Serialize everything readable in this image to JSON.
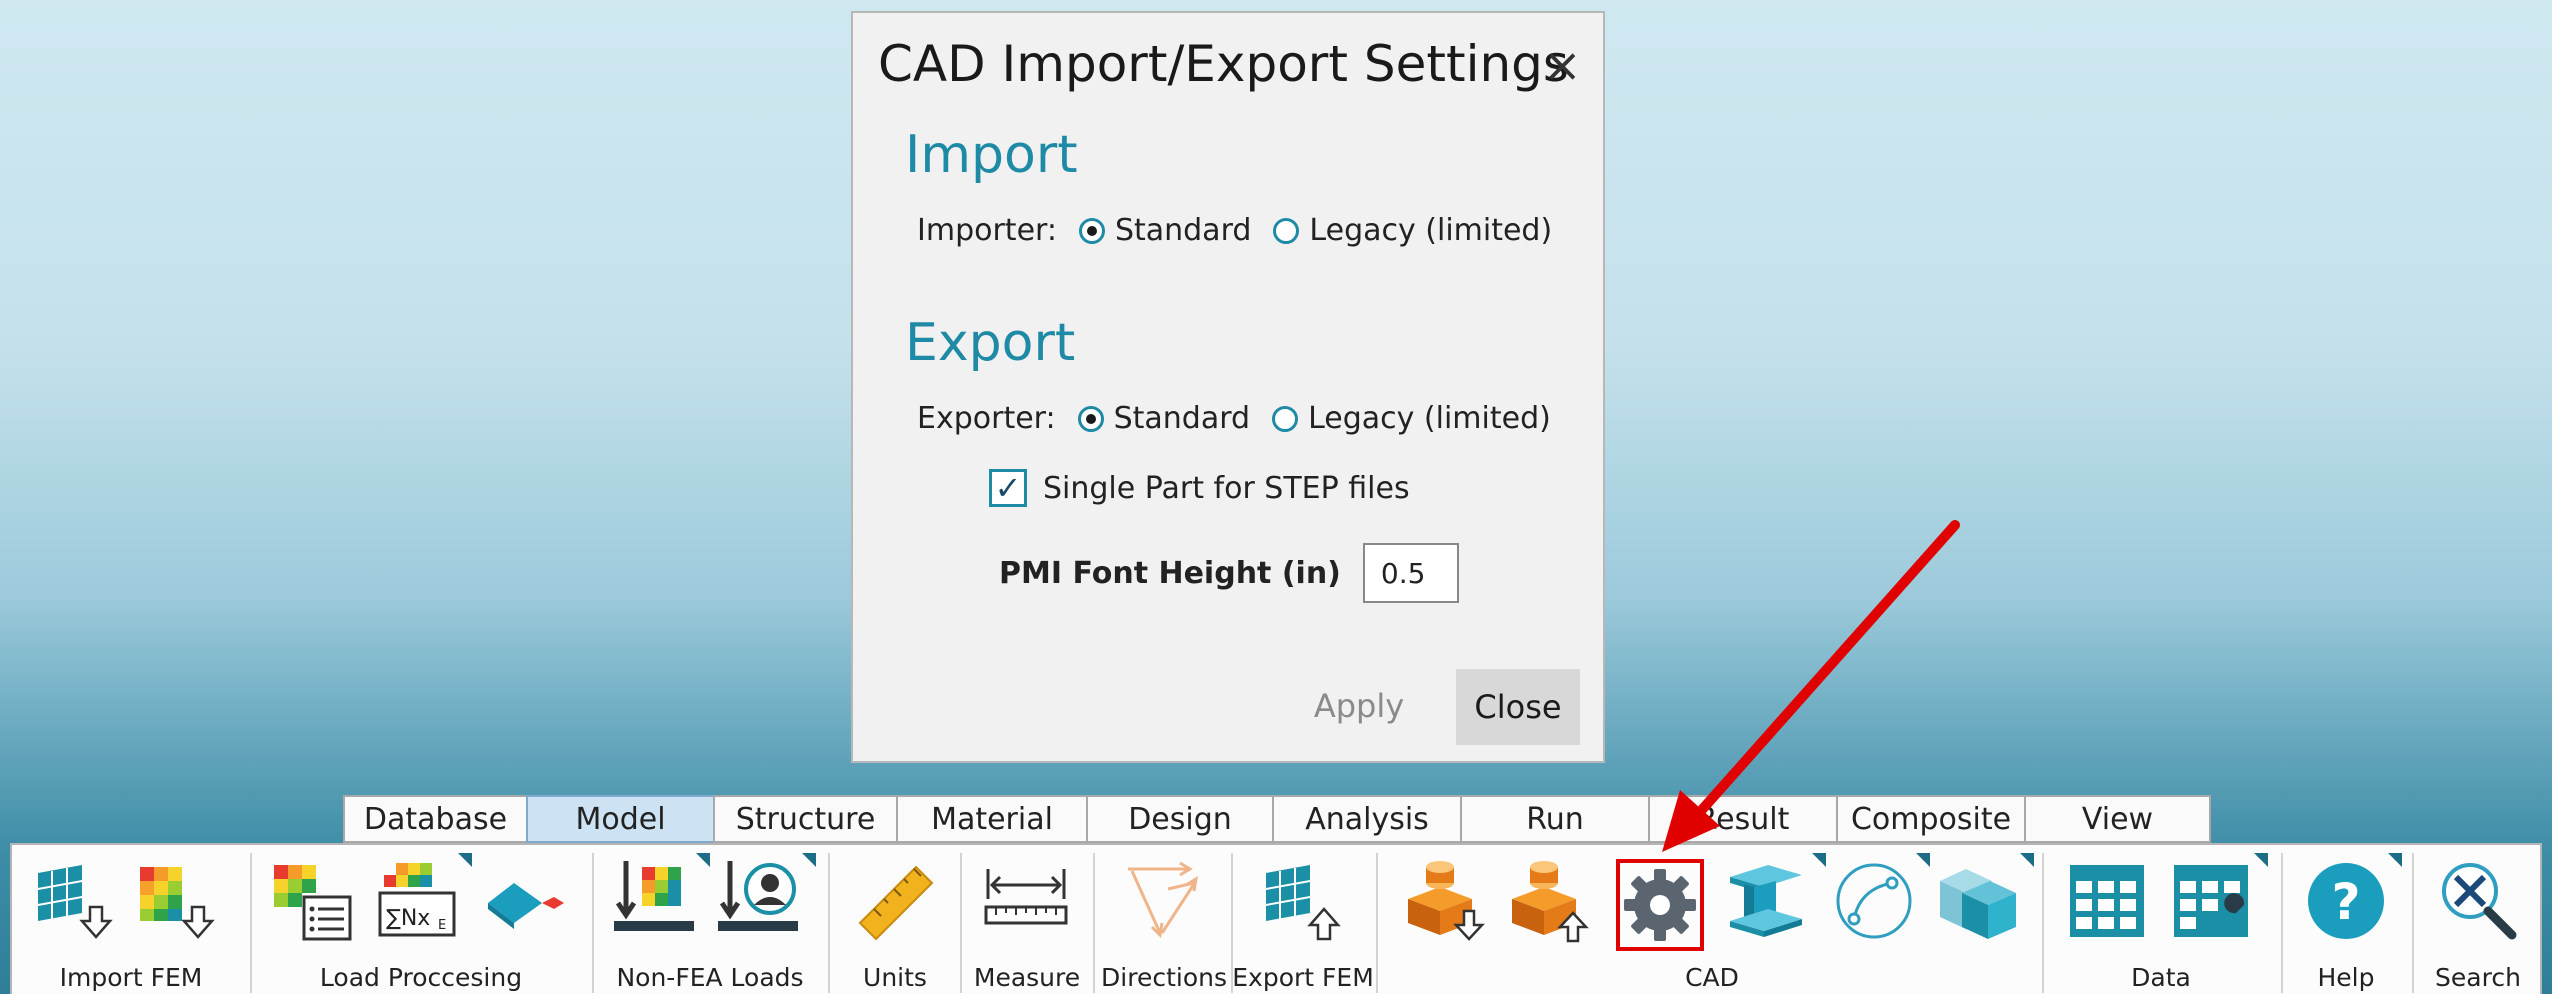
{
  "dialog": {
    "title": "CAD Import/Export Settings",
    "close_icon": "×",
    "import": {
      "heading": "Import",
      "label": "Importer:",
      "options": [
        "Standard",
        "Legacy (limited)"
      ],
      "selected": "Standard"
    },
    "export": {
      "heading": "Export",
      "label": "Exporter:",
      "options": [
        "Standard",
        "Legacy (limited)"
      ],
      "selected": "Standard"
    },
    "single_part": {
      "label": "Single Part for STEP files",
      "checked": true
    },
    "pmi": {
      "label": "PMI Font Height (in)",
      "value": "0.5"
    },
    "apply_label": "Apply",
    "close_label": "Close"
  },
  "tabs": [
    {
      "label": "Database"
    },
    {
      "label": "Model",
      "active": true
    },
    {
      "label": "Structure"
    },
    {
      "label": "Material"
    },
    {
      "label": "Design"
    },
    {
      "label": "Analysis"
    },
    {
      "label": "Run"
    },
    {
      "label": "Result"
    },
    {
      "label": "Composite"
    },
    {
      "label": "View"
    }
  ],
  "ribbon": {
    "groups": [
      {
        "label": "Import FEM"
      },
      {
        "label": "Load Proccesing"
      },
      {
        "label": "Non-FEA Loads"
      },
      {
        "label": "Units"
      },
      {
        "label": "Measure"
      },
      {
        "label": "Directions"
      },
      {
        "label": "Export FEM"
      },
      {
        "label": "CAD"
      },
      {
        "label": "Data"
      },
      {
        "label": "Help"
      },
      {
        "label": "Search"
      }
    ]
  },
  "colors": {
    "accent": "#1f8aa6",
    "highlight": "#e00000",
    "active_tab": "#cde3f3"
  },
  "icons": {
    "load_sum_text": "∑Nx",
    "load_sum_sub": "E",
    "help_glyph": "?"
  }
}
